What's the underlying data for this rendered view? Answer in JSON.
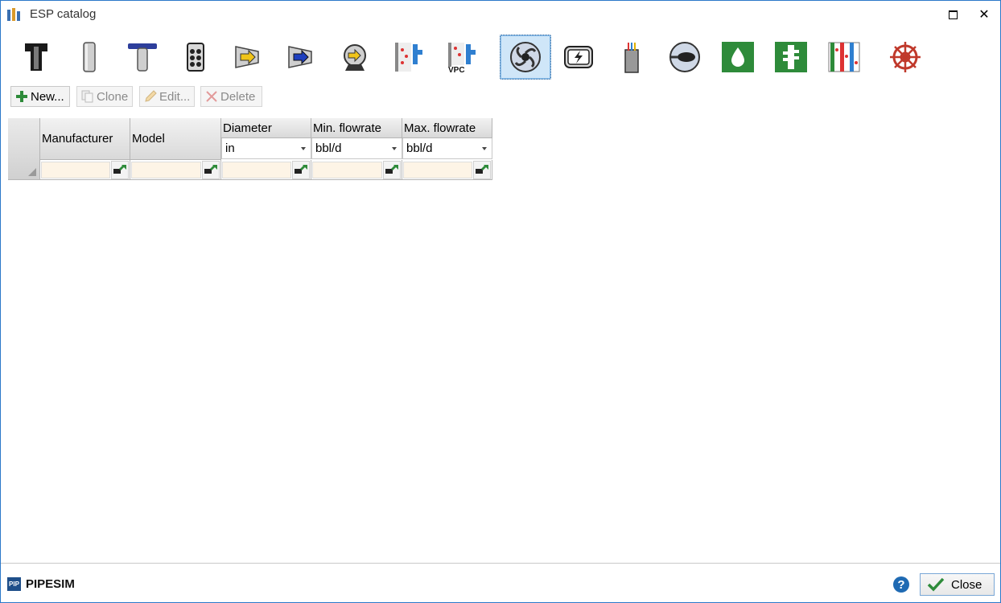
{
  "window": {
    "title": "ESP catalog"
  },
  "titlebar_buttons": {
    "maximize": "maximize",
    "close": "✕"
  },
  "icon_toolbar": [
    {
      "name": "tubing-icon"
    },
    {
      "name": "casing-icon"
    },
    {
      "name": "packer-icon"
    },
    {
      "name": "pump-module-icon"
    },
    {
      "name": "compressor-yellow-icon"
    },
    {
      "name": "compressor-blue-icon"
    },
    {
      "name": "rotary-pump-icon"
    },
    {
      "name": "separator-icon"
    },
    {
      "name": "vpc-separator-icon",
      "label": "VPC"
    },
    {
      "name": "esp-pump-icon",
      "selected": true
    },
    {
      "name": "motor-icon"
    },
    {
      "name": "cable-icon"
    },
    {
      "name": "gas-handler-icon"
    },
    {
      "name": "liquid-icon"
    },
    {
      "name": "protector-icon"
    },
    {
      "name": "multi-separator-icon"
    },
    {
      "name": "wheel-icon"
    }
  ],
  "toolbar": {
    "new_label": "New...",
    "clone_label": "Clone",
    "edit_label": "Edit...",
    "delete_label": "Delete"
  },
  "grid": {
    "columns": [
      {
        "header": "Manufacturer",
        "unit": null
      },
      {
        "header": "Model",
        "unit": null
      },
      {
        "header": "Diameter",
        "unit": "in"
      },
      {
        "header": "Min. flowrate",
        "unit": "bbl/d"
      },
      {
        "header": "Max. flowrate",
        "unit": "bbl/d"
      }
    ],
    "filters": [
      "",
      "",
      "",
      "",
      ""
    ]
  },
  "footer": {
    "brand": "PIPESIM",
    "brand_icon_text": "PIP",
    "help": "?",
    "close_label": "Close"
  },
  "colors": {
    "accent": "#1f6ab3",
    "selected_bg": "#cfe6f8",
    "filter_bg": "#fdf4e6",
    "green": "#2e8b3a"
  }
}
